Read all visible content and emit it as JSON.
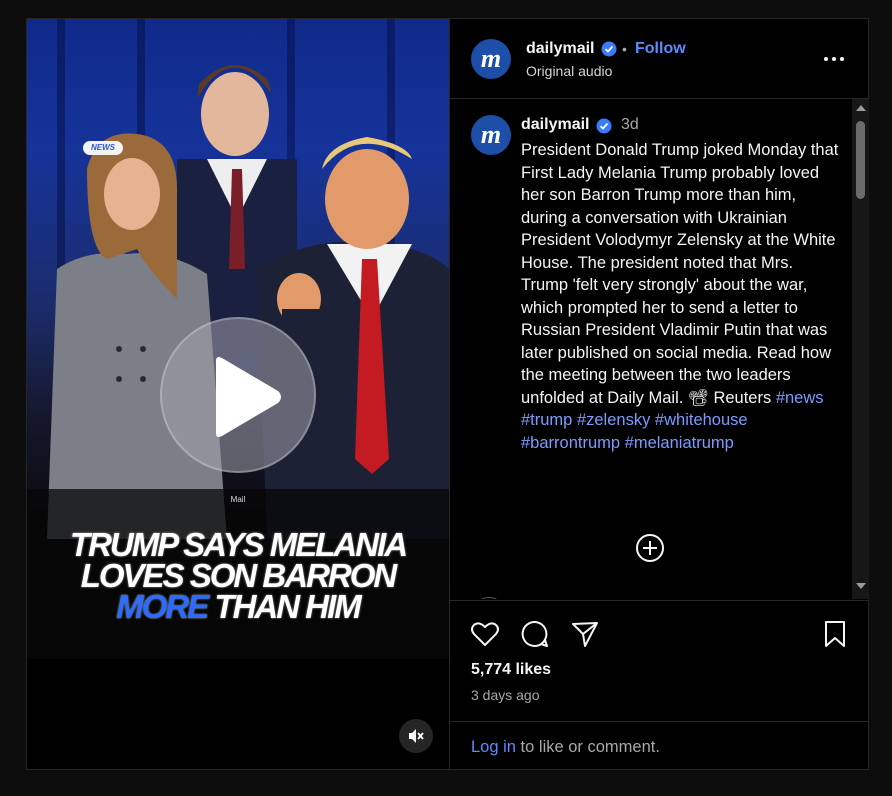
{
  "video": {
    "badge": "NEWS",
    "channel_mark": "Mail",
    "caption_line1": "TRUMP SAYS MELANIA",
    "caption_line2": "LOVES SON BARRON",
    "caption_line3_highlight": "MORE",
    "caption_line3_rest": "THAN HIM"
  },
  "header": {
    "username": "dailymail",
    "separator": "•",
    "follow_label": "Follow",
    "audio": "Original audio",
    "logo_glyph": "m"
  },
  "post": {
    "username": "dailymail",
    "age": "3d",
    "caption": "President Donald Trump joked Monday that First Lady Melania Trump probably loved her son Barron Trump more than him, during a conversation with Ukrainian President Volodymyr Zelensky at the White House. The president noted that Mrs. Trump 'felt very strongly' about the war, which prompted her to send a letter to Russian President Vladimir Putin that was later published on social media. Read how the meeting between the two leaders unfolded at Daily Mail. 📽 Reuters",
    "hashtags": [
      "#news",
      "#trump",
      "#zelensky",
      "#whitehouse",
      "#barrontrump",
      "#melaniatrump"
    ]
  },
  "stats": {
    "likes": "5,774 likes",
    "posted": "3 days ago"
  },
  "login": {
    "link": "Log in",
    "rest": " to like or comment."
  },
  "colors": {
    "accent_link": "#5b8bff",
    "hashtag": "#7a9cff",
    "verified": "#3a7bfd",
    "logo_bg": "#1d4fa8",
    "caption_highlight": "#2d6bff"
  },
  "icons": [
    "verified-icon",
    "more-options-icon",
    "add-comment-icon",
    "heart-icon",
    "comment-icon",
    "share-icon",
    "bookmark-icon",
    "mute-icon",
    "play-icon"
  ]
}
